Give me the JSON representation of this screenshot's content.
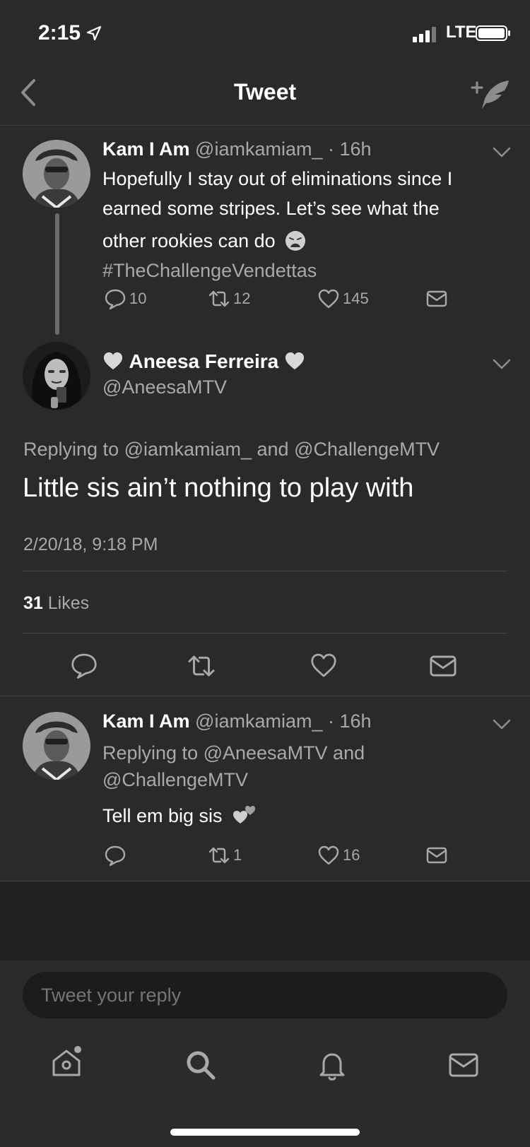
{
  "status_bar": {
    "time": "2:15",
    "network": "LTE"
  },
  "nav": {
    "title": "Tweet"
  },
  "tweet1": {
    "name": "Kam I Am",
    "handle_time": "@iamkamiam_ · 16h",
    "text_line1": "Hopefully I stay out of eliminations since I",
    "text_line2": "earned some stripes. Let’s see what the",
    "text_line3": "other rookies can do",
    "hashtag": "#TheChallengeVendettas",
    "replies": "10",
    "retweets": "12",
    "likes": "145"
  },
  "main_tweet": {
    "name": "Aneesa Ferreira",
    "handle": "@AneesaMTV",
    "replying_to": "Replying to @iamkamiam_ and @ChallengeMTV",
    "text": "Little sis ain’t nothing to play with",
    "timestamp": "2/20/18, 9:18 PM",
    "likes_count": "31",
    "likes_label": "Likes"
  },
  "tweet3": {
    "name": "Kam I Am",
    "handle_time": "@iamkamiam_ · 16h",
    "replying_line1": "Replying to @AneesaMTV and",
    "replying_line2": "@ChallengeMTV",
    "text": "Tell em big sis",
    "replies": "",
    "retweets": "1",
    "likes": "16"
  },
  "reply_box": {
    "placeholder": "Tweet your reply"
  },
  "tab_bar": {
    "items": [
      "home-icon",
      "search-icon",
      "notifications-icon",
      "messages-icon"
    ]
  }
}
